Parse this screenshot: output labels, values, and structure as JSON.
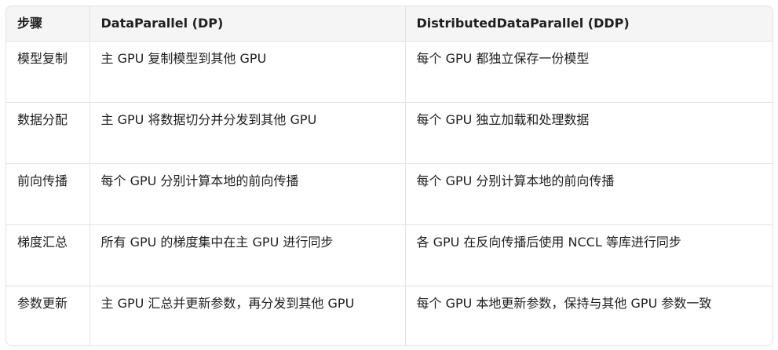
{
  "table": {
    "headers": [
      "步骤",
      "DataParallel (DP)",
      "DistributedDataParallel (DDP)"
    ],
    "rows": [
      [
        "模型复制",
        "主 GPU 复制模型到其他 GPU",
        "每个 GPU 都独立保存一份模型"
      ],
      [
        "数据分配",
        "主 GPU 将数据切分并分发到其他 GPU",
        "每个 GPU 独立加载和处理数据"
      ],
      [
        "前向传播",
        "每个 GPU 分别计算本地的前向传播",
        "每个 GPU 分别计算本地的前向传播"
      ],
      [
        "梯度汇总",
        "所有 GPU 的梯度集中在主 GPU 进行同步",
        "各 GPU 在反向传播后使用 NCCL 等库进行同步"
      ],
      [
        "参数更新",
        "主 GPU 汇总并更新参数，再分发到其他 GPU",
        "每个 GPU 本地更新参数，保持与其他 GPU 参数一致"
      ]
    ]
  }
}
